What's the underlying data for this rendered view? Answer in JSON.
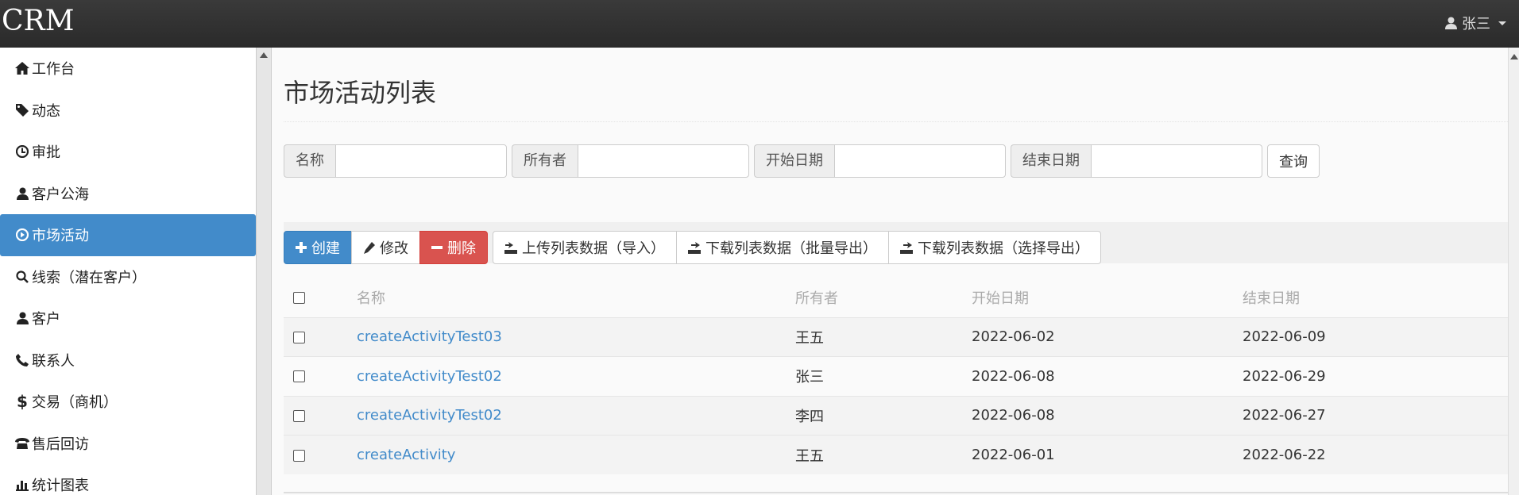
{
  "header": {
    "brand": "CRM",
    "user": "张三"
  },
  "sidebar": {
    "items": [
      {
        "label": "工作台",
        "icon": "home-icon"
      },
      {
        "label": "动态",
        "icon": "tag-icon"
      },
      {
        "label": "审批",
        "icon": "clock-icon"
      },
      {
        "label": "客户公海",
        "icon": "user-icon"
      },
      {
        "label": "市场活动",
        "icon": "play-circle-icon",
        "active": true
      },
      {
        "label": "线索（潜在客户）",
        "icon": "search-icon"
      },
      {
        "label": "客户",
        "icon": "user-icon"
      },
      {
        "label": "联系人",
        "icon": "phone-icon"
      },
      {
        "label": "交易（商机）",
        "icon": "dollar-icon"
      },
      {
        "label": "售后回访",
        "icon": "phone-alt-icon"
      },
      {
        "label": "统计图表",
        "icon": "stats-icon"
      }
    ]
  },
  "main": {
    "title": "市场活动列表",
    "search": {
      "name_label": "名称",
      "owner_label": "所有者",
      "start_label": "开始日期",
      "end_label": "结束日期",
      "query_button": "查询"
    },
    "toolbar": {
      "create": "创建",
      "edit": "修改",
      "delete": "删除",
      "upload": "上传列表数据（导入）",
      "download_all": "下载列表数据（批量导出）",
      "download_selected": "下载列表数据（选择导出）"
    },
    "table": {
      "headers": [
        "名称",
        "所有者",
        "开始日期",
        "结束日期"
      ],
      "rows": [
        {
          "name": "createActivityTest03",
          "owner": "王五",
          "start": "2022-06-02",
          "end": "2022-06-09"
        },
        {
          "name": "createActivityTest02",
          "owner": "张三",
          "start": "2022-06-08",
          "end": "2022-06-29"
        },
        {
          "name": "createActivityTest02",
          "owner": "李四",
          "start": "2022-06-08",
          "end": "2022-06-27"
        },
        {
          "name": "createActivity",
          "owner": "王五",
          "start": "2022-06-01",
          "end": "2022-06-22"
        }
      ]
    }
  },
  "colors": {
    "primary": "#428bca",
    "danger": "#d9534f",
    "topbar": "#2f2f2f"
  }
}
